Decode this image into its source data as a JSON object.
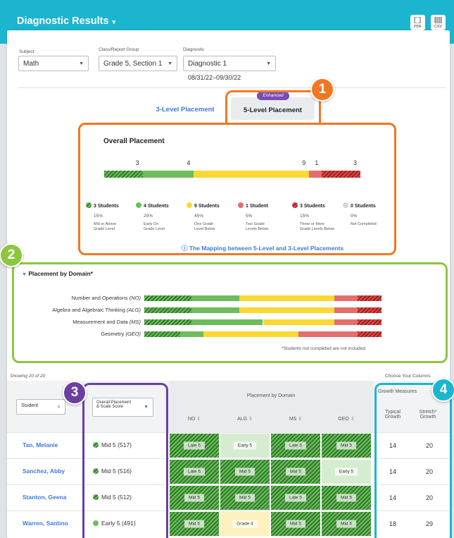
{
  "app": {
    "title": "Diagnostic Results",
    "title_caret": "▾",
    "export_pdf": "PDF",
    "export_csv": "CSV"
  },
  "filters": {
    "subject": {
      "label": "Subject",
      "value": "Math"
    },
    "class_group": {
      "label": "Class/Report Group",
      "value": "Grade 5, Section 1"
    },
    "diagnostic": {
      "label": "Diagnostic",
      "value": "Diagnostic 1",
      "dates": "08/31/22–09/30/22"
    }
  },
  "tabs": {
    "three_level": "3-Level Placement",
    "five_level": "5-Level Placement",
    "enhanced_badge": "Enhanced"
  },
  "callouts": [
    "1",
    "2",
    "3",
    "4"
  ],
  "overall": {
    "title": "Overall Placement",
    "segments": [
      {
        "count": 3,
        "color": "hatch-green"
      },
      {
        "count": 4,
        "color": "#6dbd5c"
      },
      {
        "count": 9,
        "color": "#fbd832"
      },
      {
        "count": 1,
        "color": "#e56d6d"
      },
      {
        "count": 3,
        "color": "hatch-red"
      }
    ],
    "bar_numbers": [
      "3",
      "4",
      "9",
      "1",
      "3"
    ],
    "legend": [
      {
        "students": "3 Students",
        "pct": "15%",
        "desc1": "Mid or Above",
        "desc2": "Grade Level"
      },
      {
        "students": "4 Students",
        "pct": "20%",
        "desc1": "Early On",
        "desc2": "Grade Level"
      },
      {
        "students": "9 Students",
        "pct": "45%",
        "desc1": "One Grade",
        "desc2": "Level Below"
      },
      {
        "students": "1 Student",
        "pct": "5%",
        "desc1": "Two Grade",
        "desc2": "Levels Below"
      },
      {
        "students": "3 Students",
        "pct": "15%",
        "desc1": "Three or More",
        "desc2": "Grade Levels Below"
      },
      {
        "students": "0 Students",
        "pct": "0%",
        "desc1": "Not Completed",
        "desc2": ""
      }
    ],
    "mapping_link": "The Mapping between 5-Level and 3-Level Placements",
    "info_icon": "ⓘ"
  },
  "domain": {
    "title": "Placement by Domain*",
    "rows": [
      {
        "name": "Number and Operations",
        "abbr": "(NO)",
        "fractions": [
          0.2,
          0.2,
          0.4,
          0.1,
          0.1
        ]
      },
      {
        "name": "Algebra and Algebraic Thinking",
        "abbr": "(ALG)",
        "fractions": [
          0.2,
          0.2,
          0.4,
          0.1,
          0.1
        ]
      },
      {
        "name": "Measurement and Data",
        "abbr": "(MS)",
        "fractions": [
          0.2,
          0.3,
          0.3,
          0.1,
          0.1
        ]
      },
      {
        "name": "Geometry",
        "abbr": "(GEO)",
        "fractions": [
          0.15,
          0.1,
          0.4,
          0.25,
          0.1
        ]
      }
    ],
    "footnote": "*Students not completed are not included."
  },
  "table": {
    "showing": "Showing 20 of 20",
    "choose_columns": "Choose Your Columns",
    "student_header": "Student",
    "overall_header_line1": "Overall Placement",
    "overall_header_line2": "& Scale Score",
    "domain_group_header": "Placement by Domain",
    "domain_cols": [
      "NO",
      "ALG",
      "MS",
      "GEO"
    ],
    "growth_header": "Growth Measures",
    "typical_line1": "Typical",
    "typical_line2": "Growth",
    "stretch_line1": "Stretch*",
    "stretch_line2": "Growth",
    "rows": [
      {
        "student": "Tan, Melanie",
        "placement": "Mid 5",
        "score": "(517)",
        "dot": "hatch",
        "domains": [
          {
            "label": "Late 5",
            "color": "hatch"
          },
          {
            "label": "Early 5",
            "color": "light"
          },
          {
            "label": "Late 5",
            "color": "hatch"
          },
          {
            "label": "Mid 5",
            "color": "hatch"
          }
        ],
        "typical": "14",
        "stretch": "20"
      },
      {
        "student": "Sanchez, Abby",
        "placement": "Mid 5",
        "score": "(516)",
        "dot": "hatch",
        "domains": [
          {
            "label": "Late 5",
            "color": "hatch"
          },
          {
            "label": "Mid 5",
            "color": "hatch"
          },
          {
            "label": "Mid 5",
            "color": "hatch"
          },
          {
            "label": "Early 5",
            "color": "light"
          }
        ],
        "typical": "14",
        "stretch": "20"
      },
      {
        "student": "Stanton, Geena",
        "placement": "Mid 5",
        "score": "(512)",
        "dot": "hatch",
        "domains": [
          {
            "label": "Mid 5",
            "color": "hatch"
          },
          {
            "label": "Mid 5",
            "color": "hatch"
          },
          {
            "label": "Late 5",
            "color": "hatch"
          },
          {
            "label": "Mid 5",
            "color": "hatch"
          }
        ],
        "typical": "14",
        "stretch": "20"
      },
      {
        "student": "Warren, Santino",
        "placement": "Early 5",
        "score": "(491)",
        "dot": "green",
        "domains": [
          {
            "label": "Mid 5",
            "color": "hatch"
          },
          {
            "label": "Grade 4",
            "color": "yellow"
          },
          {
            "label": "Mid 5",
            "color": "hatch"
          },
          {
            "label": "Mid 5",
            "color": "hatch"
          }
        ],
        "typical": "18",
        "stretch": "29"
      }
    ]
  },
  "colors": {
    "brand": "#1bb5cf",
    "callout1": "#f07822",
    "callout2": "#8cc63f",
    "callout3": "#6b3fa0",
    "callout4": "#1bb5cf"
  }
}
